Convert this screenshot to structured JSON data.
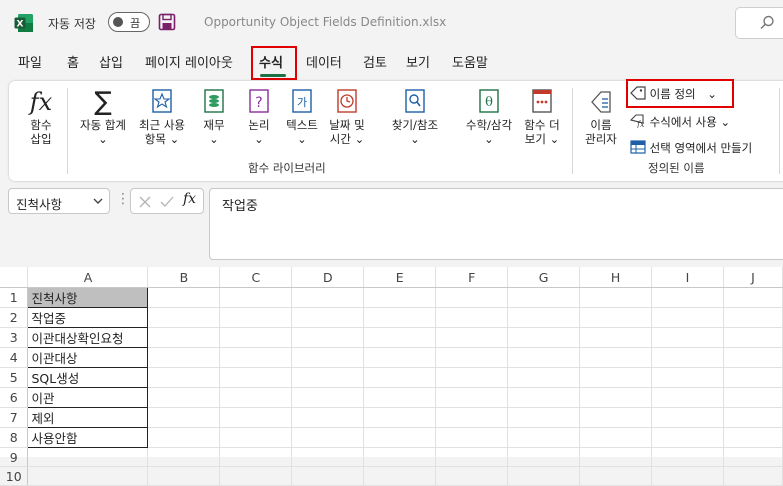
{
  "titlebar": {
    "autosave_label": "자동 저장",
    "autosave_state": "끔",
    "file_title": "Opportunity Object Fields Definition.xlsx"
  },
  "tabs": [
    "파일",
    "홈",
    "삽입",
    "페이지 레이아웃",
    "수식",
    "데이터",
    "검토",
    "보기",
    "도움말"
  ],
  "active_tab": "수식",
  "ribbon": {
    "insert_function": [
      "함수",
      "삽입"
    ],
    "autosum": [
      "자동 합계",
      "⌄"
    ],
    "recent": [
      "최근 사용",
      "항목 ⌄"
    ],
    "financial": [
      "재무",
      "⌄"
    ],
    "logical": [
      "논리",
      "⌄"
    ],
    "text": [
      "텍스트",
      "⌄"
    ],
    "datetime": [
      "날짜 및",
      "시간 ⌄"
    ],
    "lookup": [
      "찾기/참조",
      "⌄"
    ],
    "mathtrig": [
      "수학/삼각",
      "⌄"
    ],
    "more": [
      "함수 더",
      "보기 ⌄"
    ],
    "library_label": "함수 라이브러리",
    "name_manager": [
      "이름",
      "관리자"
    ],
    "define_name": "이름 정의",
    "use_in_formula": "수식에서 사용",
    "create_from_selection": "선택 영역에서 만들기",
    "defined_names_label": "정의된 이름",
    "chevron": "⌄"
  },
  "formula_bar": {
    "name_box": "진척사항",
    "content": "작업중"
  },
  "grid": {
    "columns": [
      "A",
      "B",
      "C",
      "D",
      "E",
      "F",
      "G",
      "H",
      "I",
      "J"
    ],
    "rows": [
      "1",
      "2",
      "3",
      "4",
      "5",
      "6",
      "7",
      "8",
      "9",
      "10"
    ],
    "col_a": [
      "진척사항",
      "작업중",
      "이관대상확인요청",
      "이관대상",
      "SQL생성",
      "이관",
      "제외",
      "사용안함"
    ]
  }
}
